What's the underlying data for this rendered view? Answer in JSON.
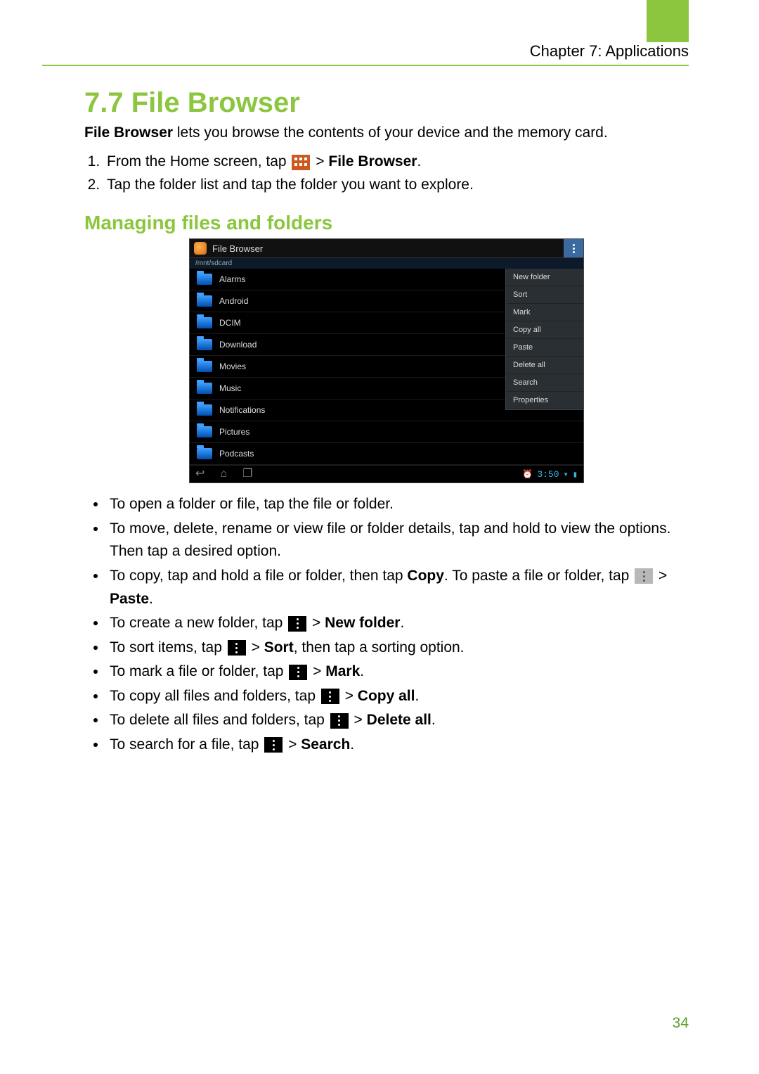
{
  "chapter_header": "Chapter 7: Applications",
  "section_title": "7.7 File Browser",
  "intro_strong": "File Browser",
  "intro_rest": " lets you browse the contents of your device and the memory card.",
  "steps": {
    "s1_a": "From the Home screen, tap ",
    "s1_b": " > ",
    "s1_c": "File Browser",
    "s1_d": ".",
    "s2": "Tap the folder list and tap the folder you want to explore."
  },
  "subhead": "Managing files and folders",
  "screenshot": {
    "app_title": "File Browser",
    "path": "/mnt/sdcard",
    "folders": [
      "Alarms",
      "Android",
      "DCIM",
      "Download",
      "Movies",
      "Music",
      "Notifications",
      "Pictures",
      "Podcasts"
    ],
    "menu": [
      "New folder",
      "Sort",
      "Mark",
      "Copy all",
      "Paste",
      "Delete all",
      "Search",
      "Properties"
    ],
    "clock": "3:50"
  },
  "bullets": {
    "b1": "To open a folder or file, tap the file or folder.",
    "b2": "To move, delete, rename or view file or folder details, tap and hold to view the options. Then tap a desired option.",
    "b3_a": "To copy, tap and hold a file or folder, then tap ",
    "b3_b": "Copy",
    "b3_c": ". To paste a file or folder, tap ",
    "b3_d": " > ",
    "b3_e": "Paste",
    "b3_f": ".",
    "b4_a": "To create a new folder, tap ",
    "b4_b": " > ",
    "b4_c": "New folder",
    "b4_d": ".",
    "b5_a": "To sort items, tap ",
    "b5_b": " > ",
    "b5_c": "Sort",
    "b5_d": ", then tap a sorting option.",
    "b6_a": "To mark a file or folder, tap ",
    "b6_b": " > ",
    "b6_c": "Mark",
    "b6_d": ".",
    "b7_a": "To copy all files and folders, tap ",
    "b7_b": " > ",
    "b7_c": "Copy all",
    "b7_d": ".",
    "b8_a": "To delete all files and folders, tap ",
    "b8_b": " > ",
    "b8_c": "Delete all",
    "b8_d": ".",
    "b9_a": "To search for a file, tap ",
    "b9_b": " > ",
    "b9_c": "Search",
    "b9_d": "."
  },
  "page_number": "34"
}
